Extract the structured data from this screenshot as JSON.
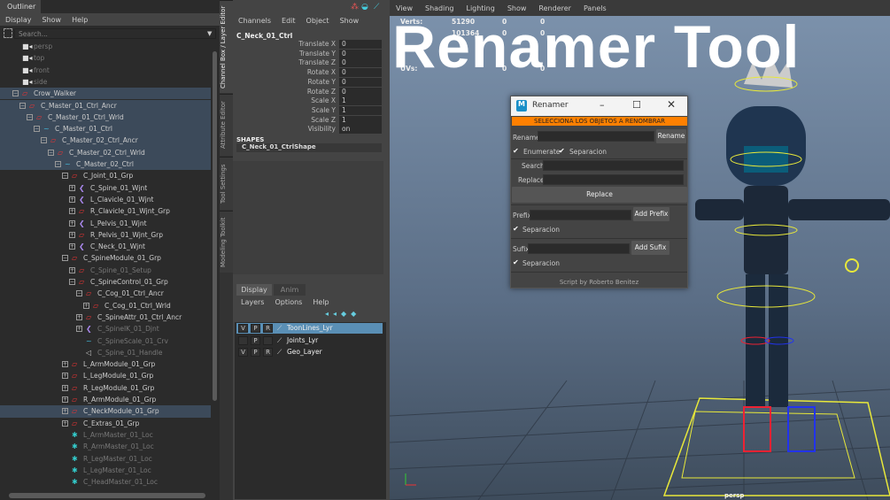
{
  "outliner": {
    "title": "Outliner",
    "menu": [
      "Display",
      "Show",
      "Help"
    ],
    "search_placeholder": "Search...",
    "items": [
      {
        "label": "persp",
        "level": 0,
        "type": "cam",
        "dim": true
      },
      {
        "label": "top",
        "level": 0,
        "type": "cam",
        "dim": true
      },
      {
        "label": "front",
        "level": 0,
        "type": "cam",
        "dim": true
      },
      {
        "label": "side",
        "level": 0,
        "type": "cam",
        "dim": true
      },
      {
        "label": "Crow_Walker",
        "level": 0,
        "type": "grp",
        "sel": true,
        "exp": "-"
      },
      {
        "label": "C_Master_01_Ctrl_Ancr",
        "level": 1,
        "type": "grp",
        "sel": true,
        "exp": "-"
      },
      {
        "label": "C_Master_01_Ctrl_Wrld",
        "level": 2,
        "type": "grp",
        "sel": true,
        "exp": "-"
      },
      {
        "label": "C_Master_01_Ctrl",
        "level": 3,
        "type": "crv",
        "sel": true,
        "exp": "-"
      },
      {
        "label": "C_Master_02_Ctrl_Ancr",
        "level": 4,
        "type": "grp",
        "sel": true,
        "exp": "-"
      },
      {
        "label": "C_Master_02_Ctrl_Wrld",
        "level": 5,
        "type": "grp",
        "sel": true,
        "exp": "-"
      },
      {
        "label": "C_Master_02_Ctrl",
        "level": 6,
        "type": "crv",
        "sel": true,
        "exp": "-"
      },
      {
        "label": "C_Joint_01_Grp",
        "level": 7,
        "type": "grp",
        "exp": "-"
      },
      {
        "label": "C_Spine_01_Wjnt",
        "level": 8,
        "type": "jnt",
        "exp": "+"
      },
      {
        "label": "L_Clavicle_01_Wjnt",
        "level": 8,
        "type": "jnt",
        "exp": "+"
      },
      {
        "label": "R_Clavicle_01_Wjnt_Grp",
        "level": 8,
        "type": "grp",
        "exp": "+"
      },
      {
        "label": "L_Pelvis_01_Wjnt",
        "level": 8,
        "type": "jnt",
        "exp": "+"
      },
      {
        "label": "R_Pelvis_01_Wjnt_Grp",
        "level": 8,
        "type": "grp",
        "exp": "+"
      },
      {
        "label": "C_Neck_01_Wjnt",
        "level": 8,
        "type": "jnt",
        "exp": "+"
      },
      {
        "label": "C_SpineModule_01_Grp",
        "level": 7,
        "type": "grp",
        "exp": "-"
      },
      {
        "label": "C_Spine_01_Setup",
        "level": 8,
        "type": "grp",
        "dim": true,
        "exp": "+"
      },
      {
        "label": "C_SpineControl_01_Grp",
        "level": 8,
        "type": "grp",
        "exp": "-"
      },
      {
        "label": "C_Cog_01_Ctrl_Ancr",
        "level": 9,
        "type": "grp",
        "exp": "-"
      },
      {
        "label": "C_Cog_01_Ctrl_Wrld",
        "level": 10,
        "type": "grp",
        "exp": "+"
      },
      {
        "label": "C_SpineAttr_01_Ctrl_Ancr",
        "level": 9,
        "type": "grp",
        "exp": "+"
      },
      {
        "label": "C_SpineIK_01_Djnt",
        "level": 9,
        "type": "jnt",
        "dim": true,
        "exp": "+"
      },
      {
        "label": "C_SpineScale_01_Crv",
        "level": 9,
        "type": "crv",
        "dim": true
      },
      {
        "label": "C_Spine_01_Handle",
        "level": 9,
        "type": "hdl",
        "dim": true
      },
      {
        "label": "L_ArmModule_01_Grp",
        "level": 7,
        "type": "grp",
        "exp": "+"
      },
      {
        "label": "L_LegModule_01_Grp",
        "level": 7,
        "type": "grp",
        "exp": "+"
      },
      {
        "label": "R_LegModule_01_Grp",
        "level": 7,
        "type": "grp",
        "exp": "+"
      },
      {
        "label": "R_ArmModule_01_Grp",
        "level": 7,
        "type": "grp",
        "exp": "+"
      },
      {
        "label": "C_NeckModule_01_Grp",
        "level": 7,
        "type": "grp",
        "sel": true,
        "exp": "+"
      },
      {
        "label": "C_Extras_01_Grp",
        "level": 7,
        "type": "grp",
        "exp": "+"
      },
      {
        "label": "L_ArmMaster_01_Loc",
        "level": 7,
        "type": "loc",
        "dim": true
      },
      {
        "label": "R_ArmMaster_01_Loc",
        "level": 7,
        "type": "loc",
        "dim": true
      },
      {
        "label": "R_LegMaster_01_Loc",
        "level": 7,
        "type": "loc",
        "dim": true
      },
      {
        "label": "L_LegMaster_01_Loc",
        "level": 7,
        "type": "loc",
        "dim": true
      },
      {
        "label": "C_HeadMaster_01_Loc",
        "level": 7,
        "type": "loc",
        "dim": true
      }
    ]
  },
  "side_tabs": [
    "Channel Box / Layer Editor",
    "Attribute Editor",
    "Tool Settings",
    "Modeling Toolkit"
  ],
  "channel_box": {
    "menu": [
      "Channels",
      "Edit",
      "Object",
      "Show"
    ],
    "object": "C_Neck_01_Ctrl",
    "attrs": [
      {
        "n": "Translate X",
        "v": "0"
      },
      {
        "n": "Translate Y",
        "v": "0"
      },
      {
        "n": "Translate Z",
        "v": "0"
      },
      {
        "n": "Rotate X",
        "v": "0"
      },
      {
        "n": "Rotate Y",
        "v": "0"
      },
      {
        "n": "Rotate Z",
        "v": "0"
      },
      {
        "n": "Scale X",
        "v": "1"
      },
      {
        "n": "Scale Y",
        "v": "1"
      },
      {
        "n": "Scale Z",
        "v": "1"
      },
      {
        "n": "Visibility",
        "v": "on"
      }
    ],
    "shapes_label": "SHAPES",
    "shape": "C_Neck_01_CtrlShape"
  },
  "layer_editor": {
    "tabs": [
      "Display",
      "Anim"
    ],
    "menu": [
      "Layers",
      "Options",
      "Help"
    ],
    "layers": [
      {
        "name": "ToonLines_Lyr",
        "v": "V",
        "p": "P",
        "r": "R",
        "sel": true
      },
      {
        "name": "Joints_Lyr",
        "v": "",
        "p": "P",
        "r": ""
      },
      {
        "name": "Geo_Layer",
        "v": "V",
        "p": "P",
        "r": "R"
      }
    ]
  },
  "viewport": {
    "menu": [
      "View",
      "Shading",
      "Lighting",
      "Show",
      "Renderer",
      "Panels"
    ],
    "stats": [
      {
        "label": "Verts:",
        "a": "51290",
        "b": "0",
        "c": "0"
      },
      {
        "label": "",
        "a": "101364",
        "b": "0",
        "c": "0"
      },
      {
        "label": "UVs:",
        "a": "",
        "b": "0",
        "c": "0"
      }
    ],
    "camera": "persp"
  },
  "overlay_title": "Renamer Tool",
  "renamer": {
    "title": "Renamer",
    "banner": "SELECCIONA LOS OBJETOS A RENOMBRAR",
    "banner_color": "#ff8000",
    "rename_label": "Rename",
    "rename_btn": "Rename",
    "enumerate": "Enumerate",
    "separacion": "Separacion",
    "search": "Search",
    "replace": "Replace",
    "replace_btn": "Replace",
    "prefix": "Prefix",
    "add_prefix": "Add Prefix",
    "sufix": "Sufix",
    "add_sufix": "Add Sufix",
    "credit": "Script by Roberto Benitez"
  }
}
